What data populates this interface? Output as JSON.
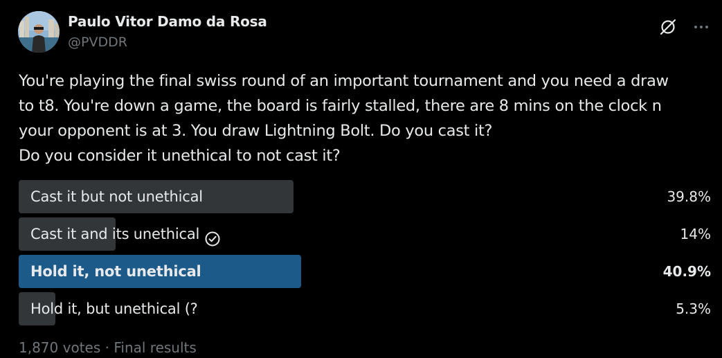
{
  "author": {
    "name": "Paulo Vitor Damo da Rosa",
    "handle": "@PVDDR"
  },
  "icons": {
    "grok": "grok-icon",
    "more": "more-icon",
    "check": "check-circle-icon"
  },
  "tweet": {
    "lines": [
      "You're playing the final swiss round of an important tournament and you need a draw",
      "to t8. You're down a game, the board is fairly stalled, there are 8 mins on the clock n",
      "your opponent is at 3. You draw Lightning Bolt. Do you cast it?",
      "Do you consider it unethical to not cast it?"
    ]
  },
  "poll": {
    "options": [
      {
        "label": "Cast it but not unethical",
        "percent_text": "39.8%",
        "percent": 39.8,
        "winner": false,
        "voted": false
      },
      {
        "label": "Cast it and its unethical",
        "percent_text": "14%",
        "percent": 14,
        "winner": false,
        "voted": true
      },
      {
        "label": "Hold it, not unethical",
        "percent_text": "40.9%",
        "percent": 40.9,
        "winner": true,
        "voted": false
      },
      {
        "label": "Hold it, but unethical (?",
        "percent_text": "5.3%",
        "percent": 5.3,
        "winner": false,
        "voted": false
      }
    ],
    "votes": "1,870 votes",
    "separator": "·",
    "status": "Final results"
  },
  "colors": {
    "background": "#000000",
    "text": "#e7e9ea",
    "muted": "#71767b",
    "bar": "#333639",
    "winner_bar": "#1c5a8a"
  }
}
